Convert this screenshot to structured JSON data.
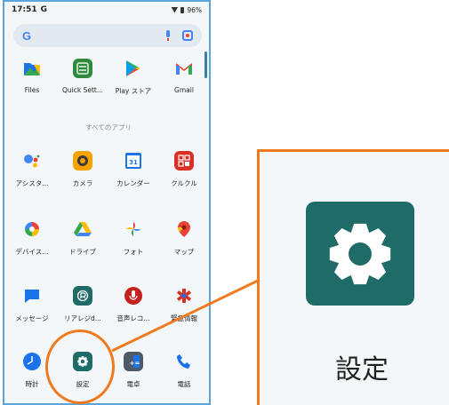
{
  "status_bar": {
    "time": "17:51",
    "google_badge": "G",
    "battery": "96%"
  },
  "search_bar": {
    "logo": "G"
  },
  "section_label": "すべてのアプリ",
  "rows": [
    [
      {
        "label": "Files",
        "icon": "files-icon",
        "color": "#1a73e8"
      },
      {
        "label": "Quick Sett...",
        "icon": "quick-settings-icon",
        "color": "#2e8b3e"
      },
      {
        "label": "Play ストア",
        "icon": "play-store-icon",
        "color": "#ffffff"
      },
      {
        "label": "Gmail",
        "icon": "gmail-icon",
        "color": "#ffffff"
      }
    ],
    [
      {
        "label": "アシスタ...",
        "icon": "assistant-icon",
        "color": "#ffffff"
      },
      {
        "label": "カメラ",
        "icon": "camera-icon",
        "color": "#f5a300"
      },
      {
        "label": "カレンダー",
        "icon": "calendar-icon",
        "color": "#ffffff"
      },
      {
        "label": "クルクル",
        "icon": "qr-icon",
        "color": "#d93025"
      }
    ],
    [
      {
        "label": "デバイス...",
        "icon": "device-icon",
        "color": "#ffffff"
      },
      {
        "label": "ドライブ",
        "icon": "drive-icon",
        "color": "#ffffff"
      },
      {
        "label": "フォト",
        "icon": "photos-icon",
        "color": "#ffffff"
      },
      {
        "label": "マップ",
        "icon": "maps-icon",
        "color": "#ffffff"
      }
    ],
    [
      {
        "label": "メッセージ",
        "icon": "messages-icon",
        "color": "#1a73e8"
      },
      {
        "label": "リアレジd...",
        "icon": "register-icon",
        "color": "#1f6b68"
      },
      {
        "label": "音声レコ...",
        "icon": "recorder-icon",
        "color": "#ffffff"
      },
      {
        "label": "緊急情報",
        "icon": "emergency-icon",
        "color": "#ffffff"
      }
    ],
    [
      {
        "label": "時計",
        "icon": "clock-icon",
        "color": "#1a73e8"
      },
      {
        "label": "設定",
        "icon": "settings-gear-icon",
        "color": "#1f6b68"
      },
      {
        "label": "電卓",
        "icon": "calculator-icon",
        "color": "#4e5a66"
      },
      {
        "label": "電話",
        "icon": "phone-icon",
        "color": "#ffffff"
      }
    ]
  ],
  "zoom": {
    "label": "設定",
    "icon": "settings-gear-icon",
    "highlight_color": "#f07a1e"
  }
}
